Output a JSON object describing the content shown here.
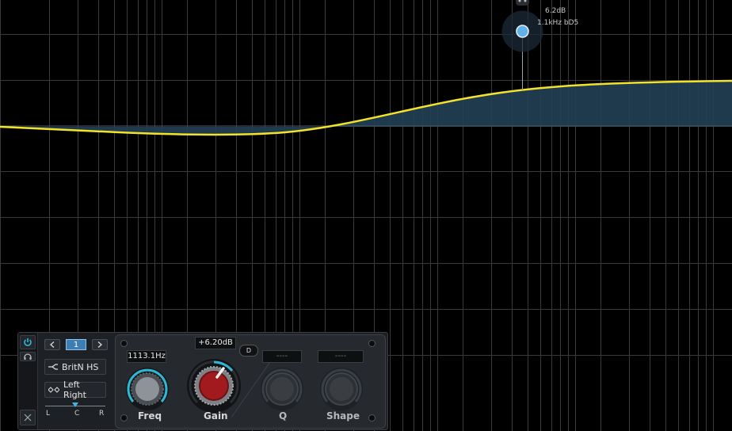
{
  "graph": {
    "node_tooltip_gain": "6.2dB",
    "node_tooltip_freq": "1.1kHz bD5",
    "curve_color": "#f2e32a",
    "fill_color": "#234055",
    "node_color": "#5fb2ea"
  },
  "panel": {
    "band_number": "1",
    "filter_type": "BritN HS",
    "channel_mode": "Left Right",
    "pan_left": "L",
    "pan_center": "C",
    "pan_right": "R",
    "freq_value": "1113.1Hz",
    "freq_label": "Freq",
    "gain_value": "+6.20dB",
    "gain_label": "Gain",
    "d_button": "D",
    "q_value": "----",
    "q_label": "Q",
    "shape_value": "----",
    "shape_label": "Shape",
    "accent_color": "#2fb8d4",
    "gain_knob_color": "#a01a1e"
  }
}
